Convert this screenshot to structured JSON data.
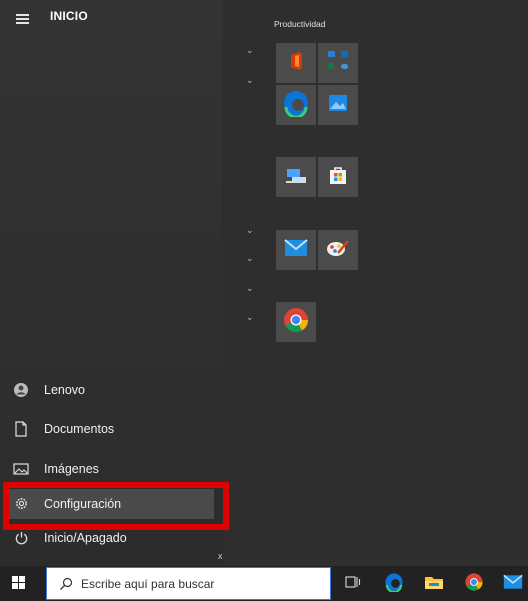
{
  "start_menu": {
    "title": "INICIO",
    "left_items": [
      {
        "label": "Lenovo",
        "icon": "user-icon"
      },
      {
        "label": "Documentos",
        "icon": "document-icon"
      },
      {
        "label": "Imágenes",
        "icon": "images-icon"
      },
      {
        "label": "Configuración",
        "icon": "gear-icon"
      },
      {
        "label": "Inicio/Apagado",
        "icon": "power-icon"
      }
    ],
    "tiles_group": "Productividad",
    "close_glyph": "x"
  },
  "taskbar": {
    "search_placeholder": "Escribe aquí para buscar"
  },
  "colors": {
    "highlight": "#e10000",
    "accent": "#3a78d8"
  }
}
